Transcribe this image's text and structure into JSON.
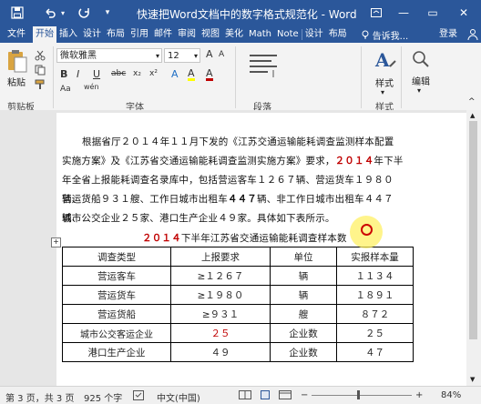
{
  "window": {
    "title": "快速把Word文档中的数字格式规范化 - Word",
    "minimize": "—",
    "restore": "▭",
    "close": "✕",
    "brand_color": "#2b579a"
  },
  "quick_access": [
    "save-icon",
    "undo-icon",
    "redo-icon",
    "customize-icon"
  ],
  "tabs": [
    "文件",
    "开始",
    "插入",
    "设计",
    "布局",
    "引用",
    "邮件",
    "审阅",
    "视图",
    "美化",
    "Math",
    "Note",
    "设计",
    "布局"
  ],
  "active_tab": "开始",
  "tell_me": "告诉我...",
  "login": "登录",
  "ribbon": {
    "paste": "粘贴",
    "clipboard": "剪贴板",
    "font_name": "微软雅黑",
    "font_size": "12",
    "font_group": "字体",
    "paragraph_group": "段落",
    "styles": "样式",
    "styles_group": "样式",
    "editing": "编辑",
    "bold": "B",
    "italic": "I",
    "underline": "U",
    "strike": "abc",
    "sub": "x₂",
    "sup": "x²",
    "font_color": "A",
    "highlight": "A",
    "wen": "wén",
    "aa": "Aa"
  },
  "document": {
    "para1_line1": "根据省厅２０１４年１１月下发的《江苏交通运输能耗调查监测样本配置",
    "para1_line2a": "实施方案》及《江苏省交通运输能耗调查监测实施方案》要求，",
    "para1_line2b": "２０１４",
    "para1_line2c": "年下半",
    "para1_line3": "年全省上报能耗调查名录库中，包括营运客车１２６７辆、营运货车１９８０辆、",
    "para1_line4a": "营运货船９３１艘、工作日城市出租车",
    "para1_line4b": "４４７",
    "para1_line4c": "辆、非工作日城市出租车４４７辆、",
    "para1_line5": "城市公交企业２５家、港口生产企业４９家。具体如下表所示。",
    "table_title_red": "２０１４",
    "table_title_rest": "下半年江苏省交通运输能耗调查样本数",
    "table": [
      [
        "调查类型",
        "上报要求",
        "单位",
        "实报样本量"
      ],
      [
        "营运客车",
        "≥１２６７",
        "辆",
        "１１３４"
      ],
      [
        "营运货车",
        "≥１９８０",
        "辆",
        "１８９１"
      ],
      [
        "营运货船",
        "≥９３１",
        "艘",
        "８７２"
      ],
      [
        "城市公交客运企业",
        "２５",
        "企业数",
        "２５"
      ],
      [
        "港口生产企业",
        "４９",
        "企业数",
        "４７"
      ]
    ]
  },
  "status": {
    "page": "第 3 页，共 3 页",
    "words": "925 个字",
    "language": "中文(中国)",
    "zoom": "84%"
  }
}
